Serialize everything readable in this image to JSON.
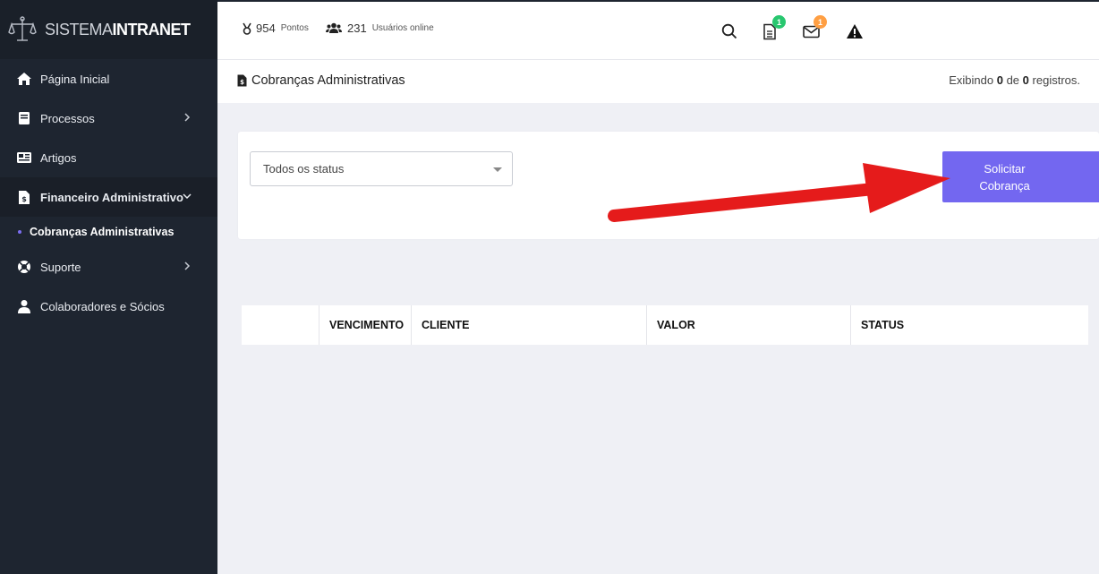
{
  "brand": {
    "name_light": "SISTEMA",
    "name_bold": "INTRANET"
  },
  "sidebar": {
    "items": [
      {
        "label": "Página Inicial",
        "icon": "home-icon"
      },
      {
        "label": "Processos",
        "icon": "book-icon"
      },
      {
        "label": "Artigos",
        "icon": "newspaper-icon"
      },
      {
        "label": "Financeiro Administrativo",
        "icon": "file-invoice-icon"
      },
      {
        "label": "Suporte",
        "icon": "lifebuoy-icon"
      },
      {
        "label": "Colaboradores e Sócios",
        "icon": "user-icon"
      }
    ],
    "submenu": {
      "label": "Cobranças Administrativas"
    }
  },
  "topbar": {
    "points": {
      "value": "954",
      "label": "Pontos"
    },
    "online": {
      "value": "231",
      "label": "Usuários online"
    },
    "icons": {
      "search": "search-icon",
      "documents": {
        "icon": "document-icon",
        "badge": "1",
        "badge_color": "#28c76f"
      },
      "messages": {
        "icon": "mail-icon",
        "badge": "1",
        "badge_color": "#ff9f43"
      },
      "alert": "warning-icon"
    }
  },
  "page": {
    "title": "Cobranças Administrativas",
    "records": {
      "prefix": "Exibindo",
      "shown": "0",
      "of": "de",
      "total": "0",
      "suffix": "registros."
    }
  },
  "filter": {
    "status_select": "Todos os status",
    "request_button_line1": "Solicitar",
    "request_button_line2": "Cobrança"
  },
  "table": {
    "columns": [
      "",
      "VENCIMENTO",
      "CLIENTE",
      "VALOR",
      "STATUS"
    ]
  },
  "colors": {
    "sidebar_bg": "#1e2530",
    "accent": "#7367f0",
    "annotation_arrow": "#e51b1b"
  }
}
